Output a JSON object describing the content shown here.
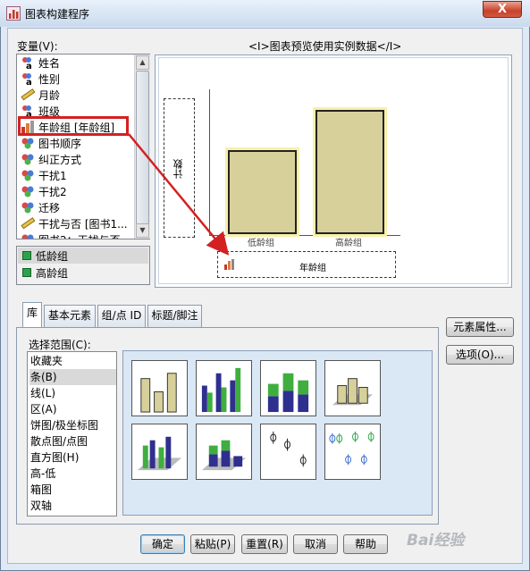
{
  "window": {
    "title": "图表构建程序",
    "close_glyph": "X"
  },
  "variables": {
    "label": "变量(V):",
    "items": [
      {
        "label": "姓名",
        "icon": "nominal-string-icon"
      },
      {
        "label": "性别",
        "icon": "nominal-string-icon"
      },
      {
        "label": "月龄",
        "icon": "scale-ruler-icon"
      },
      {
        "label": "班级",
        "icon": "nominal-string-icon"
      },
      {
        "label": "年龄组 [年龄组]",
        "icon": "ordinal-bar-icon"
      },
      {
        "label": "图书顺序",
        "icon": "nominal-balls-icon"
      },
      {
        "label": "纠正方式",
        "icon": "nominal-balls-icon"
      },
      {
        "label": "干扰1",
        "icon": "nominal-balls-icon"
      },
      {
        "label": "干扰2",
        "icon": "nominal-balls-icon"
      },
      {
        "label": "迁移",
        "icon": "nominal-balls-icon"
      },
      {
        "label": "干扰与否 [图书1...",
        "icon": "scale-ruler-icon"
      },
      {
        "label": "图书2：干扰与否",
        "icon": "nominal-balls-icon"
      }
    ]
  },
  "categories": {
    "items": [
      "低龄组",
      "高龄组"
    ]
  },
  "preview": {
    "header": "<I>图表预览使用实例数据</I>",
    "y_axis_label": "计数",
    "x_axis_label": "年龄组",
    "bars": [
      {
        "label": "低龄组",
        "value": 0.42
      },
      {
        "label": "高龄组",
        "value": 0.62
      }
    ]
  },
  "tabs": [
    "库",
    "基本元素",
    "组/点 ID",
    "标题/脚注"
  ],
  "gallery": {
    "label": "选择范围(C):",
    "items": [
      "收藏夹",
      "条(B)",
      "线(L)",
      "区(A)",
      "饼图/极坐标图",
      "散点图/点图",
      "直方图(H)",
      "高-低",
      "箱图",
      "双轴"
    ],
    "selected_index": 1,
    "thumbnails": [
      "simple-bar-icon",
      "clustered-bar-icon",
      "stacked-bar-icon",
      "3d-bar-icon",
      "3d-clustered-bar-icon",
      "3d-stacked-bar-icon",
      "simple-error-bar-icon",
      "clustered-error-bar-icon"
    ]
  },
  "side_buttons": {
    "element_props": "元素属性...",
    "options": "选项(O)..."
  },
  "footer": {
    "ok": "确定",
    "paste": "粘贴(P)",
    "reset": "重置(R)",
    "cancel": "取消",
    "help": "帮助"
  },
  "watermark": "Bai经验"
}
